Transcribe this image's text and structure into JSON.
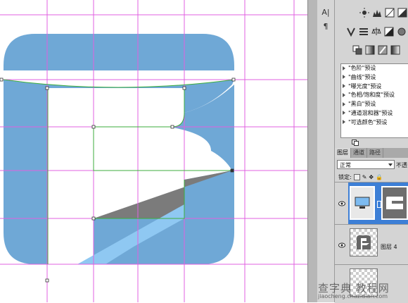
{
  "app": {
    "panel_icons": {
      "character": "A|",
      "paragraph": "¶"
    }
  },
  "canvas": {
    "logo_letter": "F",
    "logo_fill": "#6fa8d6",
    "guide_color": "#e060e0",
    "path_color": "#3cae3c",
    "fold_highlight": "#8fc8f2",
    "fold_shadow": "#7b7b7b"
  },
  "adjustments": {
    "row1": [
      "brightness-contrast-icon",
      "levels-icon",
      "curves-icon",
      "exposure-icon"
    ],
    "row2": [
      "vibrance-icon",
      "hue-saturation-icon",
      "color-balance-icon",
      "black-white-icon",
      "photo-filter-icon"
    ],
    "row3": [
      "channel-mixer-icon",
      "invert-icon",
      "posterize-icon",
      "gradient-map-icon"
    ]
  },
  "presets": [
    "\"色阶\"预设",
    "\"曲线\"预设",
    "\"曝光度\"预设",
    "\"色相/饱和度\"预设",
    "\"黑白\"预设",
    "\"通道混和器\"预设",
    "\"可选颜色\"预设"
  ],
  "layers_panel": {
    "tabs": [
      "图层",
      "通道",
      "路径"
    ],
    "active_tab": 0,
    "blend_mode": "正常",
    "opacity_label": "不透",
    "lock_label": "锁定:",
    "layers": [
      {
        "name": "",
        "selected": true
      },
      {
        "name": "图层 4",
        "selected": false
      },
      {
        "name": "",
        "selected": false
      }
    ]
  },
  "watermark": {
    "main": "查字典 教程网",
    "url": "jiaocheng.chazidian.com"
  }
}
